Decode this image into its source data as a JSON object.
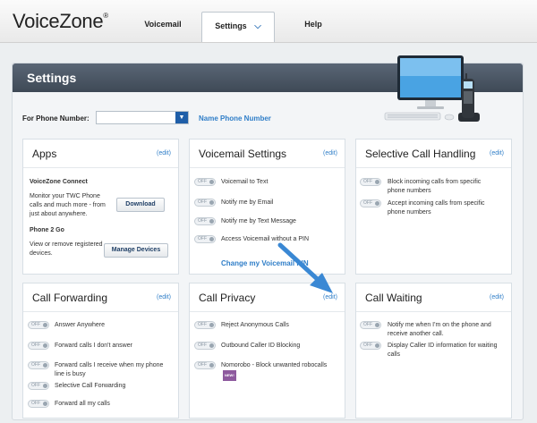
{
  "app": {
    "logo": "VoiceZone",
    "registered": "®"
  },
  "nav": {
    "voicemail": "Voicemail",
    "settings": "Settings",
    "help": "Help",
    "settings_chevron": "⌄"
  },
  "settings": {
    "title": "Settings",
    "phone_label": "For Phone Number:",
    "phone_value": "",
    "name_phone_link": "Name Phone Number"
  },
  "toggle_label": "OFF",
  "edit_label": "(edit)",
  "cards": {
    "apps": {
      "title": "Apps",
      "connect_title": "VoiceZone Connect",
      "connect_desc": "Monitor your TWC Phone calls and much more - from just about anywhere.",
      "download_button": "Download",
      "phone2go_title": "Phone 2 Go",
      "phone2go_desc": "View or remove registered devices.",
      "manage_button": "Manage Devices"
    },
    "voicemail_settings": {
      "title": "Voicemail Settings",
      "items": [
        "Voicemail to Text",
        "Notify me by Email",
        "Notify me by Text Message",
        "Access Voicemail without a PIN"
      ],
      "change_pin": "Change my Voicemail PIN"
    },
    "selective_call_handling": {
      "title": "Selective Call Handling",
      "items": [
        "Block incoming calls from specific phone numbers",
        "Accept incoming calls from specific phone numbers"
      ]
    },
    "call_forwarding": {
      "title": "Call Forwarding",
      "items": [
        "Answer Anywhere",
        "Forward calls I don't answer",
        "Forward calls I receive when my phone line is busy",
        "Selective Call Forwarding",
        "Forward all my calls"
      ]
    },
    "call_privacy": {
      "title": "Call Privacy",
      "items": [
        "Reject Anonymous Calls",
        "Outbound Caller ID Blocking",
        "Nomorobo - Block unwanted robocalls"
      ],
      "new_badge": "NEW!"
    },
    "call_waiting": {
      "title": "Call Waiting",
      "items": [
        "Notify me when I'm on the phone and receive another call.",
        "Display Caller ID information for waiting calls"
      ]
    }
  },
  "colors": {
    "accent": "#2f7ec8",
    "header": "#4a5563",
    "arrow": "#3a88d4"
  }
}
